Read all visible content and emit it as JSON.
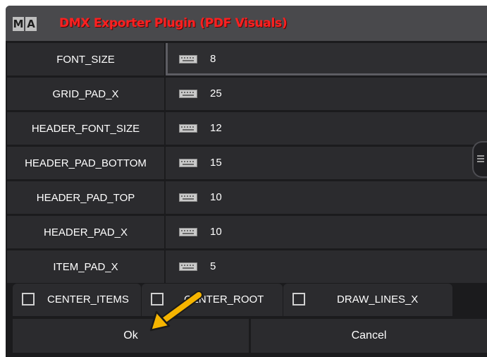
{
  "window": {
    "logo_letters": [
      "M",
      "A"
    ],
    "title": "DMX Exporter Plugin (PDF Visuals)",
    "title_color": "#ff2020"
  },
  "settings": [
    {
      "name": "FONT_SIZE",
      "value": "8"
    },
    {
      "name": "GRID_PAD_X",
      "value": "25"
    },
    {
      "name": "HEADER_FONT_SIZE",
      "value": "12"
    },
    {
      "name": "HEADER_PAD_BOTTOM",
      "value": "15"
    },
    {
      "name": "HEADER_PAD_TOP",
      "value": "10"
    },
    {
      "name": "HEADER_PAD_X",
      "value": "10"
    },
    {
      "name": "ITEM_PAD_X",
      "value": "5"
    }
  ],
  "checkboxes": [
    {
      "label": "CENTER_ITEMS",
      "checked": false
    },
    {
      "label": "CENTER_ROOT",
      "checked": false
    },
    {
      "label": "DRAW_LINES_X",
      "checked": false
    }
  ],
  "buttons": {
    "ok": "Ok",
    "cancel": "Cancel"
  },
  "icons": {
    "value_field": "keyboard-icon",
    "annotation": "arrow-pointer-icon"
  },
  "colors": {
    "background": "#1b1b1d",
    "row": "#2b2b2e",
    "titlebar": "#49494c",
    "arrow": "#f5b400"
  }
}
